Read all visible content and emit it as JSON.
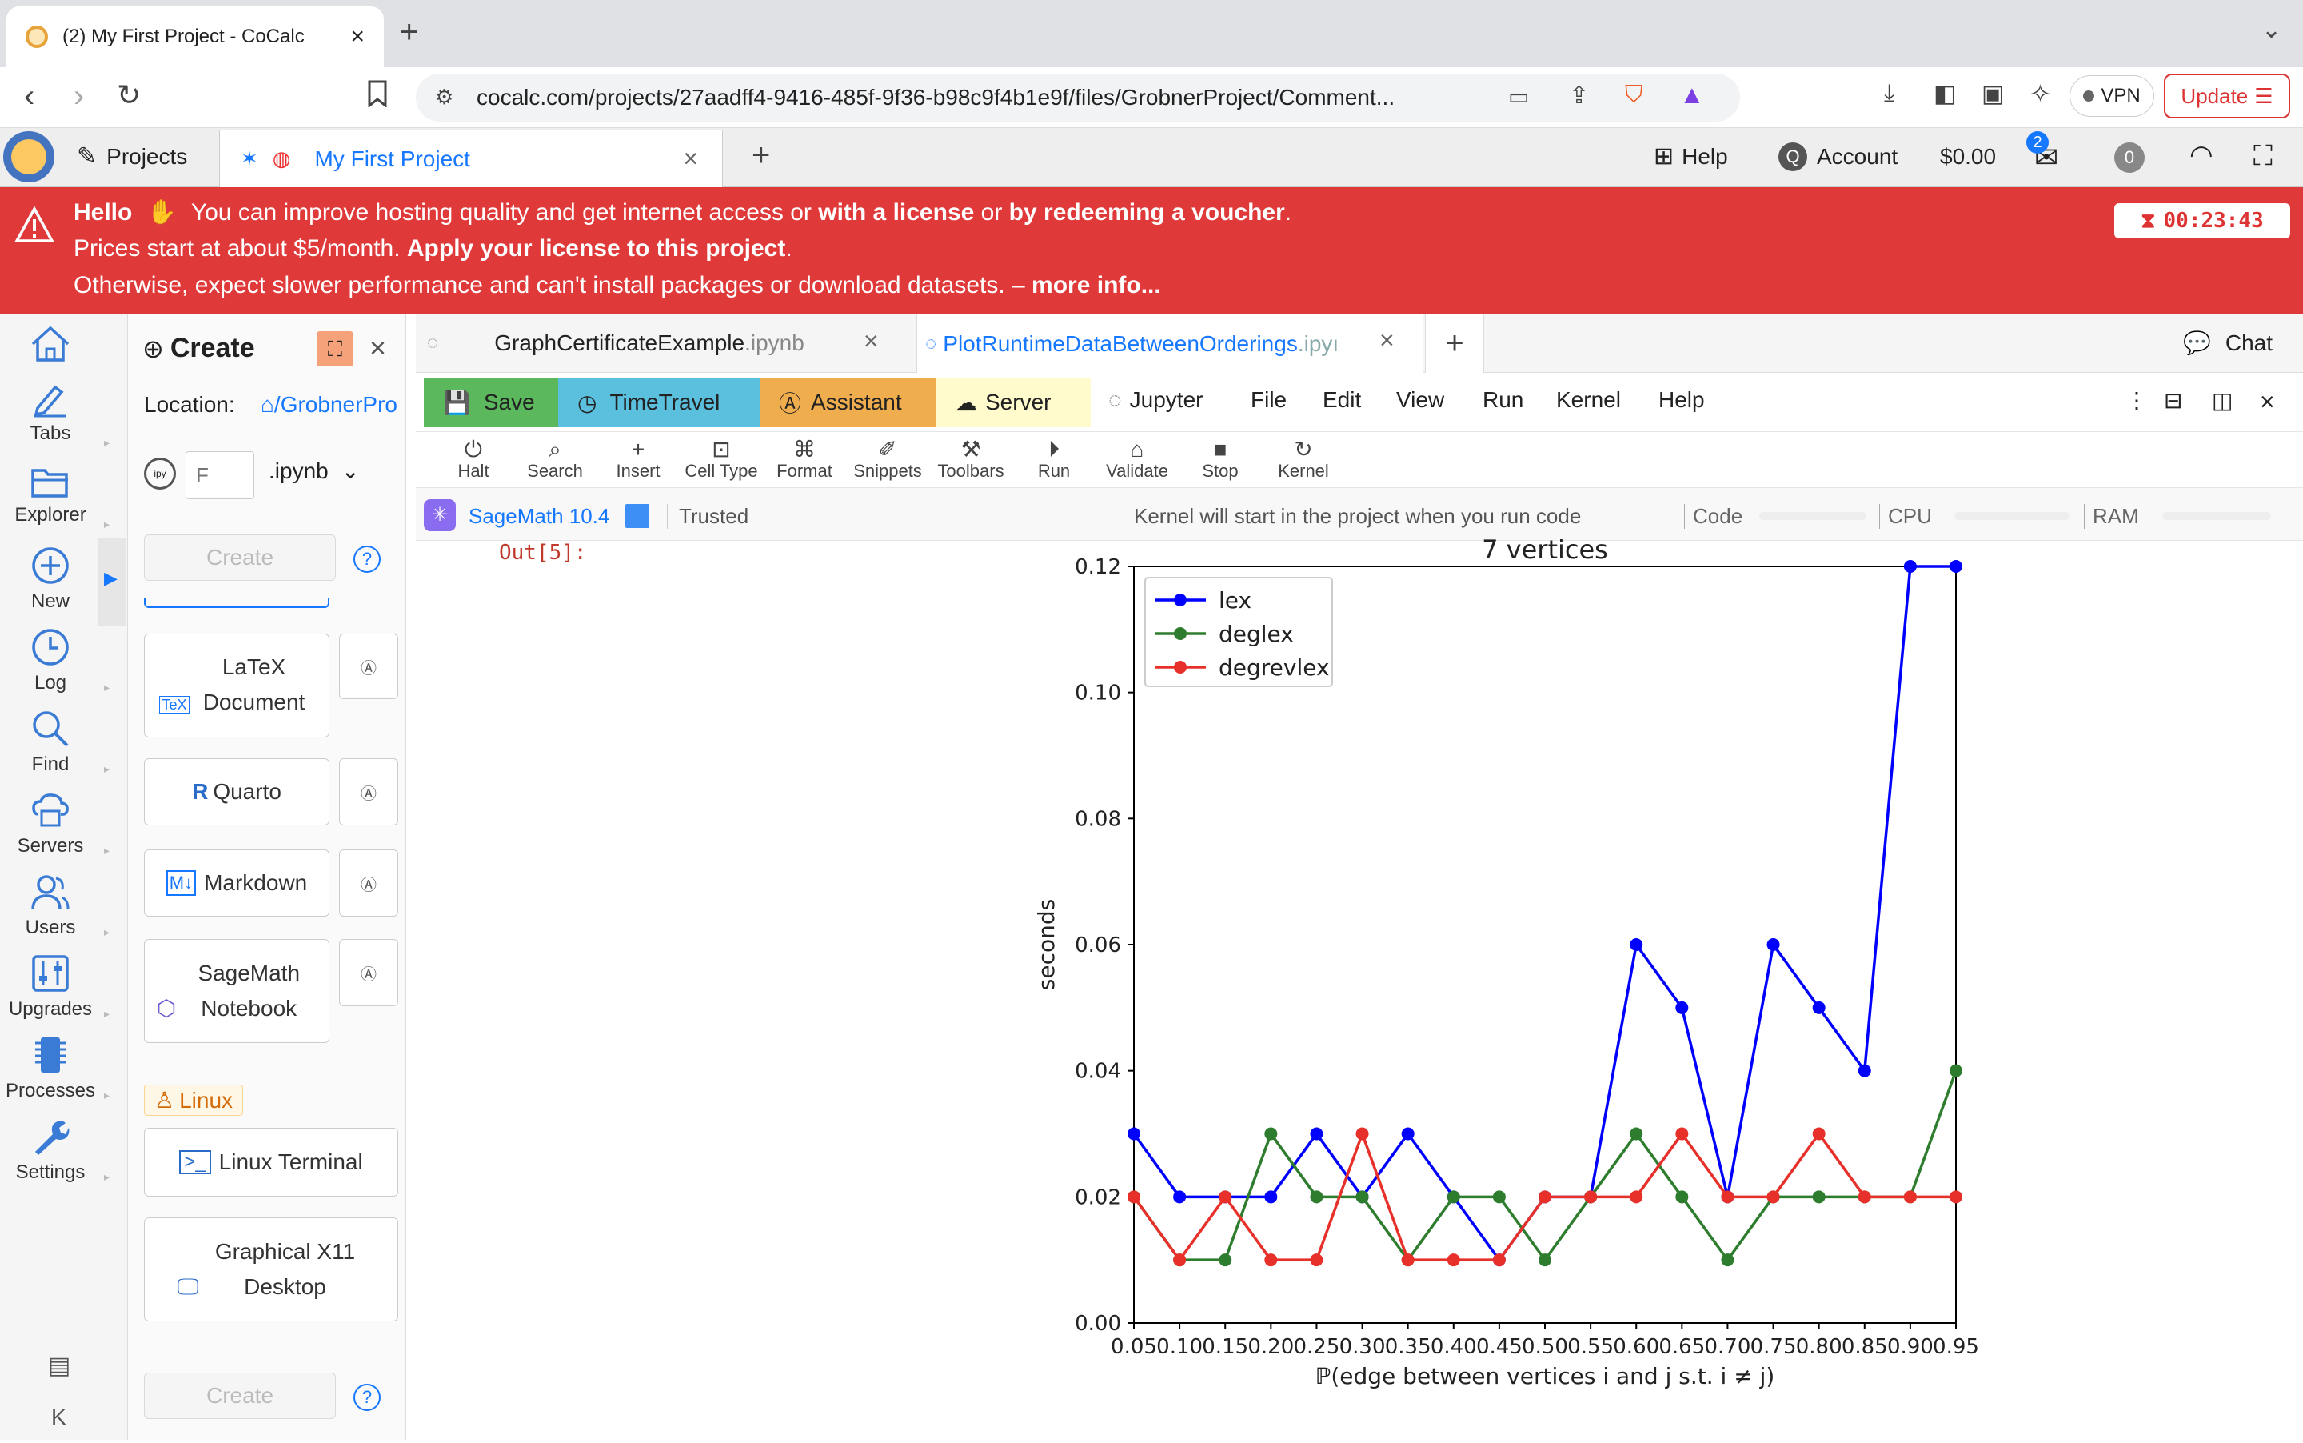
{
  "browser": {
    "tab_title": "(2) My First Project - CoCalc",
    "url": "cocalc.com/projects/27aadff4-9416-485f-9f36-b98c9f4b1e9f/files/GrobnerProject/Comment...",
    "vpn_label": "VPN",
    "update_label": "Update"
  },
  "topnav": {
    "projects_label": "Projects",
    "project_tab": "My First Project",
    "help_label": "Help",
    "account_label": "Account",
    "balance": "$0.00",
    "notif_count": "2",
    "zero_badge": "0"
  },
  "banner": {
    "hello": "Hello",
    "line1a": "You can improve hosting quality and get internet access or ",
    "license_link": "with a license",
    "line1b": " or ",
    "voucher_link": "by redeeming a voucher",
    "line1c": ".",
    "line2a": "Prices start at about $5/month. ",
    "apply_link": "Apply your license to this project",
    "line2b": ".",
    "line3a": "Otherwise, expect slower performance and can't install packages or download datasets. – ",
    "more_link": "more info...",
    "timer": "00:23:43"
  },
  "rail": {
    "items": [
      "Tabs",
      "Explorer",
      "New",
      "Log",
      "Find",
      "Servers",
      "Users",
      "Upgrades",
      "Processes",
      "Settings"
    ]
  },
  "create_panel": {
    "title": "Create",
    "location_label": "Location:",
    "location_path": "/GrobnerPro",
    "filename_placeholder": "F",
    "extension": ".ipynb",
    "create_label": "Create",
    "latex_label": "LaTeX Document",
    "quarto_label": "Quarto",
    "markdown_label": "Markdown",
    "sage_label": "SageMath Notebook",
    "linux_tag": "Linux",
    "terminal_label": "Linux Terminal",
    "x11_label": "Graphical X11 Desktop"
  },
  "file_tabs": {
    "tab1_name": "GraphCertificateExample",
    "tab1_ext": ".ipynb",
    "tab2_name": "PlotRuntimeDataBetweenOrderings",
    "tab2_ext": ".ipyı",
    "chat_label": "Chat"
  },
  "menubar": {
    "save": "Save",
    "timetravel": "TimeTravel",
    "assistant": "Assistant",
    "server": "Server",
    "jupyter": "Jupyter",
    "menus": [
      "File",
      "Edit",
      "View",
      "Run",
      "Kernel",
      "Help"
    ]
  },
  "toolbar": {
    "tools": [
      "Halt",
      "Search",
      "Insert",
      "Cell Type",
      "Format",
      "Snippets",
      "Toolbars",
      "Run",
      "Validate",
      "Stop",
      "Kernel"
    ]
  },
  "status": {
    "kernel_name": "SageMath 10.4",
    "trusted": "Trusted",
    "message": "Kernel will start in the project when you run code",
    "code": "Code",
    "cpu": "CPU",
    "ram": "RAM"
  },
  "cell": {
    "out_prompt": "Out[5]:"
  },
  "chart_data": {
    "type": "line",
    "title": "7 vertices",
    "xlabel": "ℙ(edge between vertices i and j s.t. i ≠ j)",
    "ylabel": "seconds",
    "x": [
      0.05,
      0.1,
      0.15,
      0.2,
      0.25,
      0.3,
      0.35,
      0.4,
      0.45,
      0.5,
      0.55,
      0.6,
      0.65,
      0.7,
      0.75,
      0.8,
      0.85,
      0.9,
      0.95
    ],
    "x_tick_labels": [
      "0.05",
      "0.10",
      "0.15",
      "0.20",
      "0.25",
      "0.30",
      "0.35",
      "0.40",
      "0.45",
      "0.50",
      "0.55",
      "0.60",
      "0.65",
      "0.70",
      "0.75",
      "0.80",
      "0.85",
      "0.90",
      "0.95"
    ],
    "y_tick_labels": [
      "0.00",
      "0.02",
      "0.04",
      "0.06",
      "0.08",
      "0.10",
      "0.12"
    ],
    "xlim": [
      0.05,
      0.95
    ],
    "ylim": [
      0.0,
      0.12
    ],
    "legend_position": "upper left",
    "grid": false,
    "series": [
      {
        "name": "lex",
        "color": "#0000ff",
        "values": [
          0.03,
          0.02,
          0.02,
          0.02,
          0.03,
          0.02,
          0.03,
          0.02,
          0.01,
          0.02,
          0.02,
          0.06,
          0.05,
          0.02,
          0.06,
          0.05,
          0.04,
          0.12,
          0.12
        ]
      },
      {
        "name": "deglex",
        "color": "#2e7d2e",
        "values": [
          0.02,
          0.01,
          0.01,
          0.03,
          0.02,
          0.02,
          0.01,
          0.02,
          0.02,
          0.01,
          0.02,
          0.03,
          0.02,
          0.01,
          0.02,
          0.02,
          0.02,
          0.02,
          0.04
        ]
      },
      {
        "name": "degrevlex",
        "color": "#e8302a",
        "values": [
          0.02,
          0.01,
          0.02,
          0.01,
          0.01,
          0.03,
          0.01,
          0.01,
          0.01,
          0.02,
          0.02,
          0.02,
          0.03,
          0.02,
          0.02,
          0.03,
          0.02,
          0.02,
          0.02
        ]
      }
    ]
  }
}
